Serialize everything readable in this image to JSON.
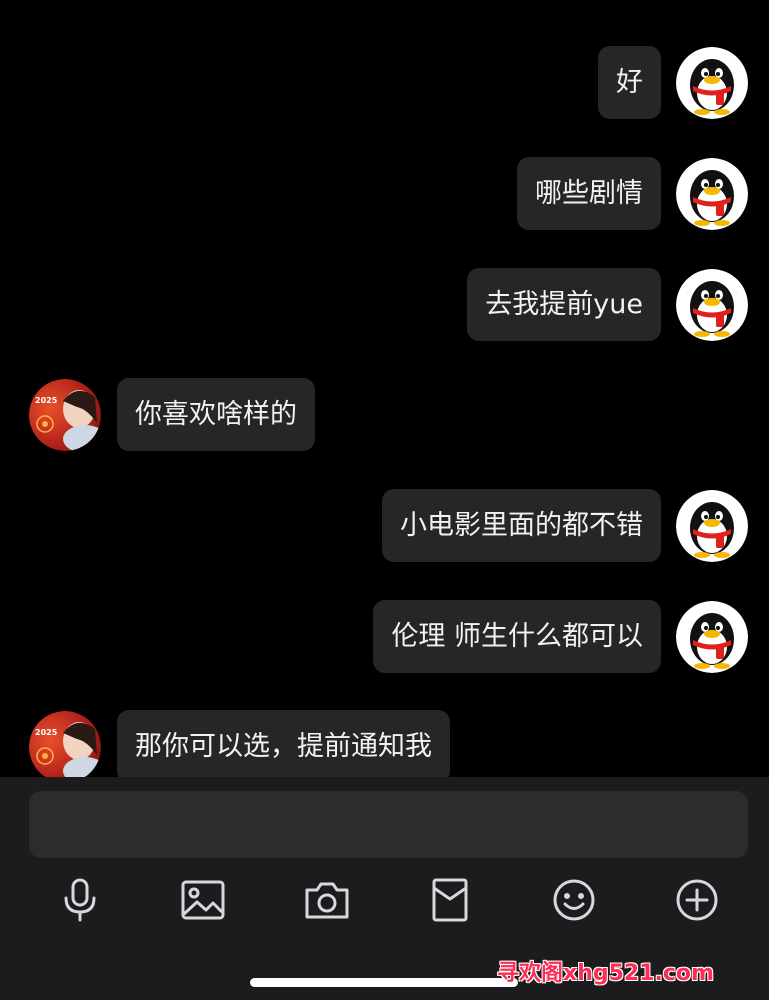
{
  "messages": [
    {
      "direction": "out",
      "text": "好"
    },
    {
      "direction": "out",
      "text": "哪些剧情"
    },
    {
      "direction": "out",
      "text": "去我提前yue"
    },
    {
      "direction": "in",
      "text": "你喜欢啥样的"
    },
    {
      "direction": "out",
      "text": "小电影里面的都不错"
    },
    {
      "direction": "out",
      "text": "伦理 师生什么都可以"
    },
    {
      "direction": "in",
      "text": "那你可以选，提前通知我"
    }
  ],
  "avatars": {
    "self": "qq-penguin-avatar",
    "contact": {
      "icon": "photo-avatar",
      "badge_text": "2025"
    }
  },
  "composer": {
    "input_value": "",
    "toolbar": [
      {
        "icon": "microphone-icon"
      },
      {
        "icon": "image-icon"
      },
      {
        "icon": "camera-icon"
      },
      {
        "icon": "red-packet-icon"
      },
      {
        "icon": "emoji-icon"
      },
      {
        "icon": "plus-icon"
      }
    ]
  },
  "watermark": "寻欢阁xhg521.com",
  "colors": {
    "background": "#000000",
    "bubble": "#262628",
    "bubble_text": "#f2f2f2",
    "composer": "#1c1c1e",
    "input": "#2c2c2e",
    "watermark": "#ff2d55"
  }
}
